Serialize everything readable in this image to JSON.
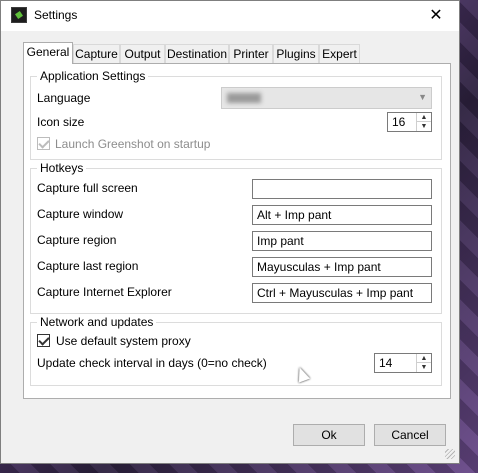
{
  "window": {
    "title": "Settings"
  },
  "tabs": [
    "General",
    "Capture",
    "Output",
    "Destination",
    "Printer",
    "Plugins",
    "Expert"
  ],
  "application_settings": {
    "legend": "Application Settings",
    "language_label": "Language",
    "icon_size_label": "Icon size",
    "icon_size_value": "16",
    "launch_on_startup_label": "Launch Greenshot on startup",
    "launch_on_startup_checked": true
  },
  "hotkeys": {
    "legend": "Hotkeys",
    "rows": [
      {
        "label": "Capture full screen",
        "value": ""
      },
      {
        "label": "Capture window",
        "value": "Alt + Imp pant"
      },
      {
        "label": "Capture region",
        "value": "Imp pant"
      },
      {
        "label": "Capture last region",
        "value": "Mayusculas + Imp pant"
      },
      {
        "label": "Capture Internet Explorer",
        "value": "Ctrl + Mayusculas + Imp pant"
      }
    ]
  },
  "network": {
    "legend": "Network and updates",
    "use_proxy_label": "Use default system proxy",
    "use_proxy_checked": true,
    "update_interval_label": "Update check interval in days (0=no check)",
    "update_interval_value": "14"
  },
  "buttons": {
    "ok": "Ok",
    "cancel": "Cancel"
  },
  "icons": {
    "app": "greenshot-app-icon",
    "close": "close-icon"
  }
}
